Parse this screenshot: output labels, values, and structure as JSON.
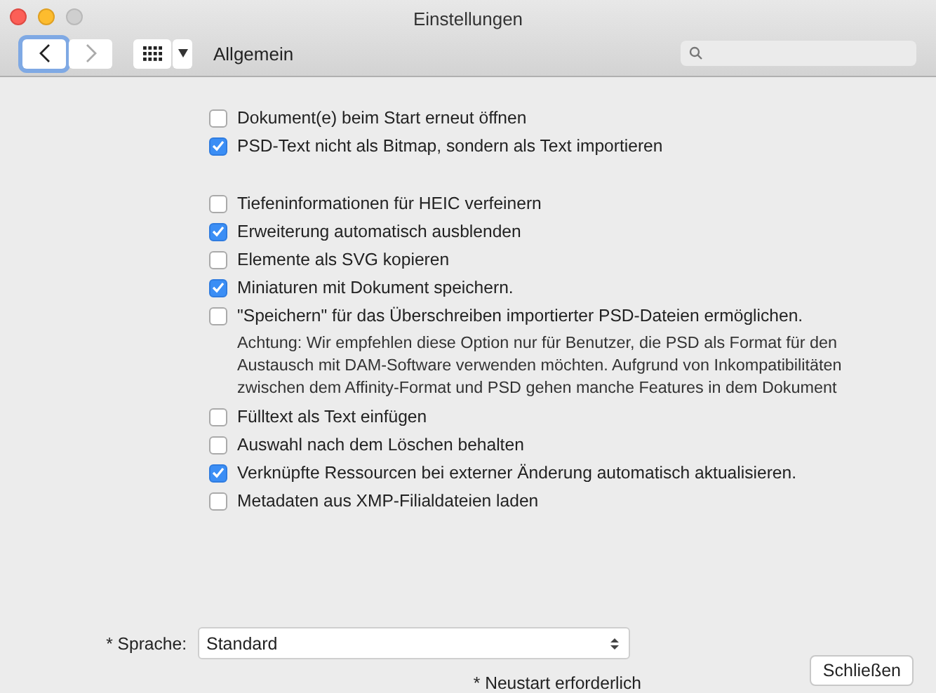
{
  "window": {
    "title": "Einstellungen"
  },
  "toolbar": {
    "section": "Allgemein"
  },
  "groups": [
    [
      {
        "kind": "checkbox",
        "label": "Dokument(e) beim Start erneut öffnen",
        "checked": false
      },
      {
        "kind": "checkbox",
        "label": "PSD-Text nicht als Bitmap, sondern als Text importieren",
        "checked": true
      }
    ],
    [
      {
        "kind": "checkbox",
        "label": "Tiefeninformationen für HEIC verfeinern",
        "checked": false
      },
      {
        "kind": "checkbox",
        "label": "Erweiterung automatisch ausblenden",
        "checked": true
      },
      {
        "kind": "checkbox",
        "label": "Elemente als SVG kopieren",
        "checked": false
      },
      {
        "kind": "checkbox",
        "label": "Miniaturen mit Dokument speichern.",
        "checked": true
      },
      {
        "kind": "checkbox",
        "label": "\"Speichern\" für das Überschreiben importierter PSD-Dateien ermöglichen.",
        "checked": false
      },
      {
        "kind": "note",
        "text": "Achtung: Wir empfehlen diese Option nur für Benutzer, die PSD als Format für den\nAustausch mit DAM-Software verwenden möchten. Aufgrund von Inkompatibilitäten\nzwischen dem Affinity-Format und PSD gehen manche Features in dem Dokument"
      },
      {
        "kind": "checkbox",
        "label": "Fülltext als Text einfügen",
        "checked": false
      },
      {
        "kind": "checkbox",
        "label": "Auswahl nach dem Löschen behalten",
        "checked": false
      },
      {
        "kind": "checkbox",
        "label": "Verknüpfte Ressourcen bei externer Änderung automatisch aktualisieren.",
        "checked": true
      },
      {
        "kind": "checkbox",
        "label": "Metadaten aus XMP-Filialdateien laden",
        "checked": false
      }
    ]
  ],
  "language": {
    "label": "* Sprache:",
    "value": "Standard",
    "hint": "* Neustart erforderlich"
  },
  "close_button": "Schließen"
}
